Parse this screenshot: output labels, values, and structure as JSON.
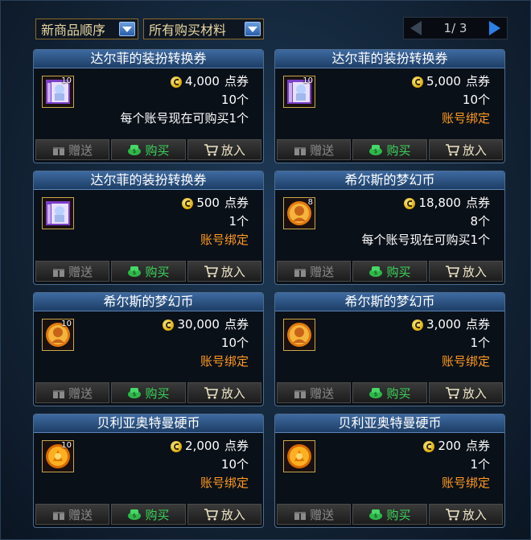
{
  "toolbar": {
    "sort_label": "新商品顺序",
    "filter_label": "所有购买材料",
    "page_text": "1/ 3"
  },
  "colors": {
    "bound_text": "#ff9a1e",
    "buy_button": "#3ad45a",
    "title_bar": "#2b5286"
  },
  "buttons": {
    "gift": "赠送",
    "buy": "购买",
    "cart": "放入"
  },
  "cards": [
    {
      "title": "达尔菲的装扮转换券",
      "price": "4,000",
      "unit": "点券",
      "quantity": "10个",
      "note": "每个账号现在可购买1个",
      "icon": "costume-ticket-icon",
      "icon_qty": "10"
    },
    {
      "title": "达尔菲的装扮转换券",
      "price": "5,000",
      "unit": "点券",
      "quantity": "10个",
      "note": "账号绑定",
      "icon": "costume-ticket-icon",
      "icon_qty": "10"
    },
    {
      "title": "达尔菲的装扮转换券",
      "price": "500",
      "unit": "点券",
      "quantity": "1个",
      "note": "账号绑定",
      "icon": "costume-ticket-icon",
      "icon_qty": ""
    },
    {
      "title": "希尔斯的梦幻币",
      "price": "18,800",
      "unit": "点券",
      "quantity": "8个",
      "note": "每个账号现在可购买1个",
      "icon": "dream-coin-icon",
      "icon_qty": "8"
    },
    {
      "title": "希尔斯的梦幻币",
      "price": "30,000",
      "unit": "点券",
      "quantity": "10个",
      "note": "账号绑定",
      "icon": "dream-coin-icon",
      "icon_qty": "10"
    },
    {
      "title": "希尔斯的梦幻币",
      "price": "3,000",
      "unit": "点券",
      "quantity": "1个",
      "note": "账号绑定",
      "icon": "dream-coin-icon",
      "icon_qty": ""
    },
    {
      "title": "贝利亚奥特曼硬币",
      "price": "2,000",
      "unit": "点券",
      "quantity": "10个",
      "note": "账号绑定",
      "icon": "ultraman-coin-icon",
      "icon_qty": "10"
    },
    {
      "title": "贝利亚奥特曼硬币",
      "price": "200",
      "unit": "点券",
      "quantity": "1个",
      "note": "账号绑定",
      "icon": "ultraman-coin-icon",
      "icon_qty": ""
    }
  ]
}
